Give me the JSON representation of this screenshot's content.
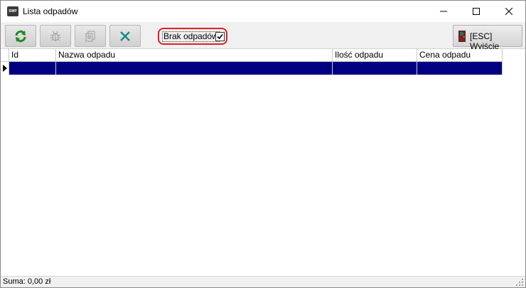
{
  "window": {
    "title": "Lista odpadów",
    "app_icon_text": "SWP"
  },
  "toolbar": {
    "buttons": [
      {
        "icon": "refresh-icon",
        "enabled": true
      },
      {
        "icon": "bug-icon",
        "enabled": false
      },
      {
        "icon": "copy-icon",
        "enabled": false
      },
      {
        "icon": "cross-icon",
        "enabled": true
      }
    ],
    "checkbox_label": "Brak odpadów",
    "checkbox_checked": true,
    "exit_label": "[ESC] Wyjście"
  },
  "grid": {
    "columns": [
      "Id",
      "Nazwa odpadu",
      "Ilość odpadu",
      "Cena odpadu"
    ],
    "rows": [
      {
        "id": "",
        "name": "",
        "quantity": "",
        "price": ""
      }
    ],
    "selection_color": "#000080"
  },
  "status": {
    "text": "Suma: 0,00 zł"
  }
}
